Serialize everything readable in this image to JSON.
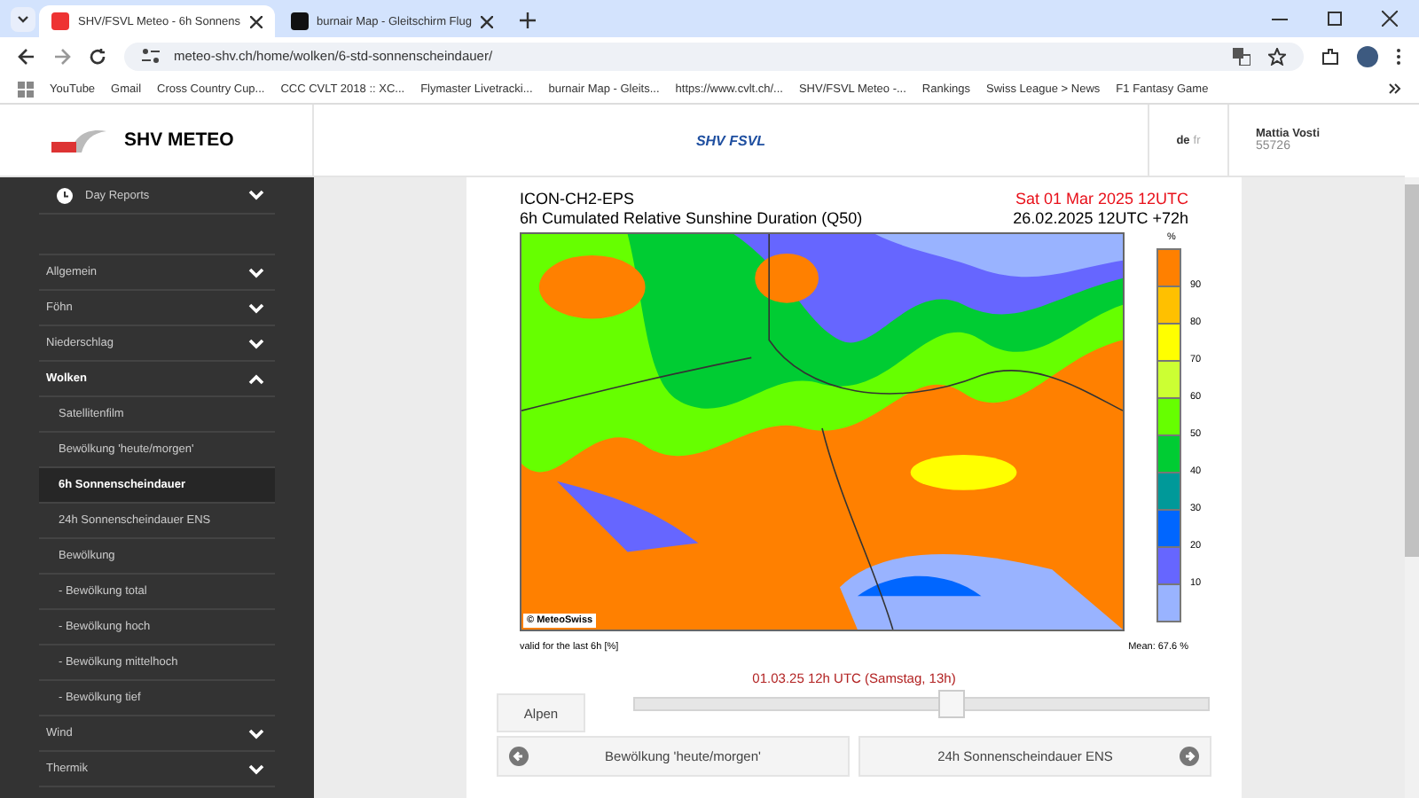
{
  "browser": {
    "tabs": [
      {
        "title": "SHV/FSVL Meteo - 6h Sonnens",
        "selected": true
      },
      {
        "title": "burnair Map - Gleitschirm Flug",
        "selected": false
      }
    ],
    "url": "meteo-shv.ch/home/wolken/6-std-sonnenscheindauer/",
    "bookmarks": [
      "YouTube",
      "Gmail",
      "Cross Country Cup...",
      "CCC CVLT 2018 :: XC...",
      "Flymaster Livetracki...",
      "burnair Map - Gleits...",
      "https://www.cvlt.ch/...",
      "SHV/FSVL Meteo -...",
      "Rankings",
      "Swiss League > News",
      "F1 Fantasy Game"
    ]
  },
  "header": {
    "site_title": "SHV METEO",
    "center_logo": "SHV FSVL",
    "languages": [
      {
        "code": "de",
        "selected": true
      },
      {
        "code": "fr",
        "selected": false
      }
    ],
    "user": {
      "name": "Mattia Vosti",
      "id": "55726"
    }
  },
  "sidebar": {
    "day_reports": "Day Reports",
    "items": [
      {
        "label": "Allgemein",
        "kind": "section",
        "expanded": false,
        "selected": false
      },
      {
        "label": "Föhn",
        "kind": "section",
        "expanded": false,
        "selected": false
      },
      {
        "label": "Niederschlag",
        "kind": "section",
        "expanded": false,
        "selected": false
      },
      {
        "label": "Wolken",
        "kind": "section",
        "expanded": true,
        "selected": false
      },
      {
        "label": "Satellitenfilm",
        "kind": "sub",
        "selected": false
      },
      {
        "label": "Bewölkung 'heute/morgen'",
        "kind": "sub",
        "selected": false
      },
      {
        "label": "6h Sonnenscheindauer",
        "kind": "sub",
        "selected": true
      },
      {
        "label": "24h Sonnenscheindauer ENS",
        "kind": "sub",
        "selected": false
      },
      {
        "label": "Bewölkung",
        "kind": "sub",
        "selected": false
      },
      {
        "label": "- Bewölkung total",
        "kind": "sub",
        "selected": false
      },
      {
        "label": "- Bewölkung hoch",
        "kind": "sub",
        "selected": false
      },
      {
        "label": "- Bewölkung mittelhoch",
        "kind": "sub",
        "selected": false
      },
      {
        "label": "- Bewölkung tief",
        "kind": "sub",
        "selected": false
      },
      {
        "label": "Wind",
        "kind": "section",
        "expanded": false,
        "selected": false
      },
      {
        "label": "Thermik",
        "kind": "section",
        "expanded": false,
        "selected": false
      }
    ]
  },
  "forecast": {
    "model": "ICON-CH2-EPS",
    "title": "6h Cumulated Relative Sunshine Duration (Q50)",
    "valid_time": "Sat 01 Mar 2025 12UTC",
    "run": "26.02.2025 12UTC +72h",
    "credit": "© MeteoSwiss",
    "unit": "%",
    "legend": [
      {
        "color": "#ff8000",
        "tick": "90"
      },
      {
        "color": "#ffc000",
        "tick": "80"
      },
      {
        "color": "#ffff00",
        "tick": "70"
      },
      {
        "color": "#ccff33",
        "tick": "60"
      },
      {
        "color": "#66ff00",
        "tick": "50"
      },
      {
        "color": "#00cc33",
        "tick": "40"
      },
      {
        "color": "#009999",
        "tick": "30"
      },
      {
        "color": "#0066ff",
        "tick": "20"
      },
      {
        "color": "#6666ff",
        "tick": "10"
      },
      {
        "color": "#99b3ff"
      }
    ],
    "footnote": "valid for the last 6h [%]",
    "mean": "Mean:  67.6 %"
  },
  "time_label": "01.03.25 12h UTC (Samstag, 13h)",
  "region_button": "Alpen",
  "slider": {
    "level": 0.55
  },
  "nav": {
    "previous": "Bewölkung 'heute/morgen'",
    "next": "24h Sonnenscheindauer ENS"
  }
}
